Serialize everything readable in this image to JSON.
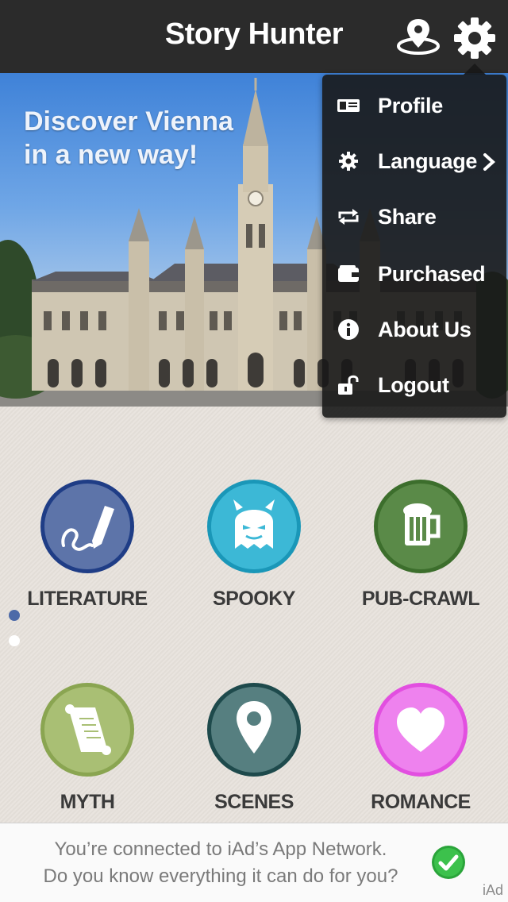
{
  "app": {
    "title": "Story Hunter"
  },
  "header": {
    "location_icon": "map-pin-icon",
    "settings_icon": "gear-icon"
  },
  "hero": {
    "line1": "Discover Vienna",
    "line2": "in a new way!"
  },
  "categories": [
    {
      "label": "LITERATURE",
      "icon": "pen-icon",
      "color": "#5d74a9"
    },
    {
      "label": "SPOOKY",
      "icon": "ghost-icon",
      "color": "#3cb8d6"
    },
    {
      "label": "PUB-CRAWL",
      "icon": "beer-mug-icon",
      "color": "#5a8a48"
    },
    {
      "label": "MYTH",
      "icon": "scroll-icon",
      "color": "#a9bf74"
    },
    {
      "label": "SCENES",
      "icon": "map-pin-icon",
      "color": "#567f80"
    },
    {
      "label": "ROMANCE",
      "icon": "heart-icon",
      "color": "#ee82ee"
    }
  ],
  "pager": {
    "active_color": "#4d6aa8",
    "inactive_color": "#ffffff"
  },
  "settings_menu": {
    "items": [
      {
        "label": "Profile",
        "icon": "id-card-icon"
      },
      {
        "label": "Language",
        "icon": "gear-icon"
      },
      {
        "label": "Share",
        "icon": "repeat-icon"
      },
      {
        "label": "Purchased",
        "icon": "wallet-icon"
      },
      {
        "label": "About Us",
        "icon": "info-icon"
      },
      {
        "label": "Logout",
        "icon": "unlock-icon"
      }
    ]
  },
  "banner": {
    "line1": "You’re connected to iAd’s App Network.",
    "line2": "Do you know everything it can do for you?",
    "tag": "iAd"
  }
}
